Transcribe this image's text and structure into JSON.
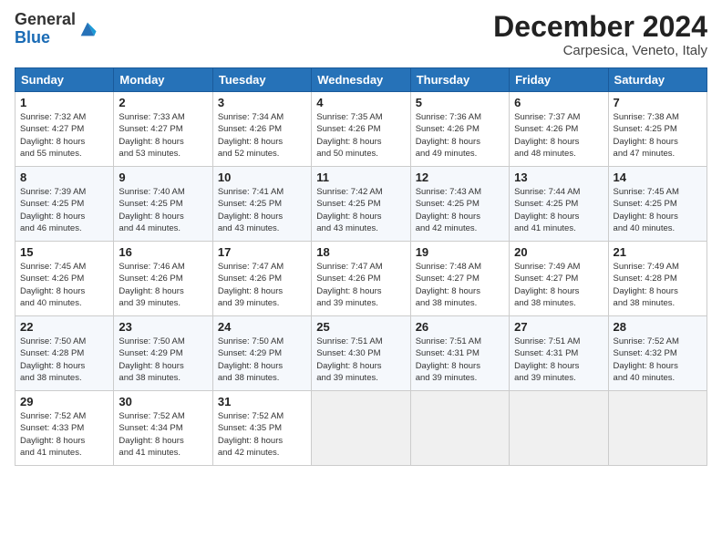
{
  "header": {
    "logo_line1": "General",
    "logo_line2": "Blue",
    "month": "December 2024",
    "location": "Carpesica, Veneto, Italy"
  },
  "weekdays": [
    "Sunday",
    "Monday",
    "Tuesday",
    "Wednesday",
    "Thursday",
    "Friday",
    "Saturday"
  ],
  "weeks": [
    [
      {
        "day": "1",
        "info": "Sunrise: 7:32 AM\nSunset: 4:27 PM\nDaylight: 8 hours\nand 55 minutes."
      },
      {
        "day": "2",
        "info": "Sunrise: 7:33 AM\nSunset: 4:27 PM\nDaylight: 8 hours\nand 53 minutes."
      },
      {
        "day": "3",
        "info": "Sunrise: 7:34 AM\nSunset: 4:26 PM\nDaylight: 8 hours\nand 52 minutes."
      },
      {
        "day": "4",
        "info": "Sunrise: 7:35 AM\nSunset: 4:26 PM\nDaylight: 8 hours\nand 50 minutes."
      },
      {
        "day": "5",
        "info": "Sunrise: 7:36 AM\nSunset: 4:26 PM\nDaylight: 8 hours\nand 49 minutes."
      },
      {
        "day": "6",
        "info": "Sunrise: 7:37 AM\nSunset: 4:26 PM\nDaylight: 8 hours\nand 48 minutes."
      },
      {
        "day": "7",
        "info": "Sunrise: 7:38 AM\nSunset: 4:25 PM\nDaylight: 8 hours\nand 47 minutes."
      }
    ],
    [
      {
        "day": "8",
        "info": "Sunrise: 7:39 AM\nSunset: 4:25 PM\nDaylight: 8 hours\nand 46 minutes."
      },
      {
        "day": "9",
        "info": "Sunrise: 7:40 AM\nSunset: 4:25 PM\nDaylight: 8 hours\nand 44 minutes."
      },
      {
        "day": "10",
        "info": "Sunrise: 7:41 AM\nSunset: 4:25 PM\nDaylight: 8 hours\nand 43 minutes."
      },
      {
        "day": "11",
        "info": "Sunrise: 7:42 AM\nSunset: 4:25 PM\nDaylight: 8 hours\nand 43 minutes."
      },
      {
        "day": "12",
        "info": "Sunrise: 7:43 AM\nSunset: 4:25 PM\nDaylight: 8 hours\nand 42 minutes."
      },
      {
        "day": "13",
        "info": "Sunrise: 7:44 AM\nSunset: 4:25 PM\nDaylight: 8 hours\nand 41 minutes."
      },
      {
        "day": "14",
        "info": "Sunrise: 7:45 AM\nSunset: 4:25 PM\nDaylight: 8 hours\nand 40 minutes."
      }
    ],
    [
      {
        "day": "15",
        "info": "Sunrise: 7:45 AM\nSunset: 4:26 PM\nDaylight: 8 hours\nand 40 minutes."
      },
      {
        "day": "16",
        "info": "Sunrise: 7:46 AM\nSunset: 4:26 PM\nDaylight: 8 hours\nand 39 minutes."
      },
      {
        "day": "17",
        "info": "Sunrise: 7:47 AM\nSunset: 4:26 PM\nDaylight: 8 hours\nand 39 minutes."
      },
      {
        "day": "18",
        "info": "Sunrise: 7:47 AM\nSunset: 4:26 PM\nDaylight: 8 hours\nand 39 minutes."
      },
      {
        "day": "19",
        "info": "Sunrise: 7:48 AM\nSunset: 4:27 PM\nDaylight: 8 hours\nand 38 minutes."
      },
      {
        "day": "20",
        "info": "Sunrise: 7:49 AM\nSunset: 4:27 PM\nDaylight: 8 hours\nand 38 minutes."
      },
      {
        "day": "21",
        "info": "Sunrise: 7:49 AM\nSunset: 4:28 PM\nDaylight: 8 hours\nand 38 minutes."
      }
    ],
    [
      {
        "day": "22",
        "info": "Sunrise: 7:50 AM\nSunset: 4:28 PM\nDaylight: 8 hours\nand 38 minutes."
      },
      {
        "day": "23",
        "info": "Sunrise: 7:50 AM\nSunset: 4:29 PM\nDaylight: 8 hours\nand 38 minutes."
      },
      {
        "day": "24",
        "info": "Sunrise: 7:50 AM\nSunset: 4:29 PM\nDaylight: 8 hours\nand 38 minutes."
      },
      {
        "day": "25",
        "info": "Sunrise: 7:51 AM\nSunset: 4:30 PM\nDaylight: 8 hours\nand 39 minutes."
      },
      {
        "day": "26",
        "info": "Sunrise: 7:51 AM\nSunset: 4:31 PM\nDaylight: 8 hours\nand 39 minutes."
      },
      {
        "day": "27",
        "info": "Sunrise: 7:51 AM\nSunset: 4:31 PM\nDaylight: 8 hours\nand 39 minutes."
      },
      {
        "day": "28",
        "info": "Sunrise: 7:52 AM\nSunset: 4:32 PM\nDaylight: 8 hours\nand 40 minutes."
      }
    ],
    [
      {
        "day": "29",
        "info": "Sunrise: 7:52 AM\nSunset: 4:33 PM\nDaylight: 8 hours\nand 41 minutes."
      },
      {
        "day": "30",
        "info": "Sunrise: 7:52 AM\nSunset: 4:34 PM\nDaylight: 8 hours\nand 41 minutes."
      },
      {
        "day": "31",
        "info": "Sunrise: 7:52 AM\nSunset: 4:35 PM\nDaylight: 8 hours\nand 42 minutes."
      },
      {
        "day": "",
        "info": ""
      },
      {
        "day": "",
        "info": ""
      },
      {
        "day": "",
        "info": ""
      },
      {
        "day": "",
        "info": ""
      }
    ]
  ]
}
